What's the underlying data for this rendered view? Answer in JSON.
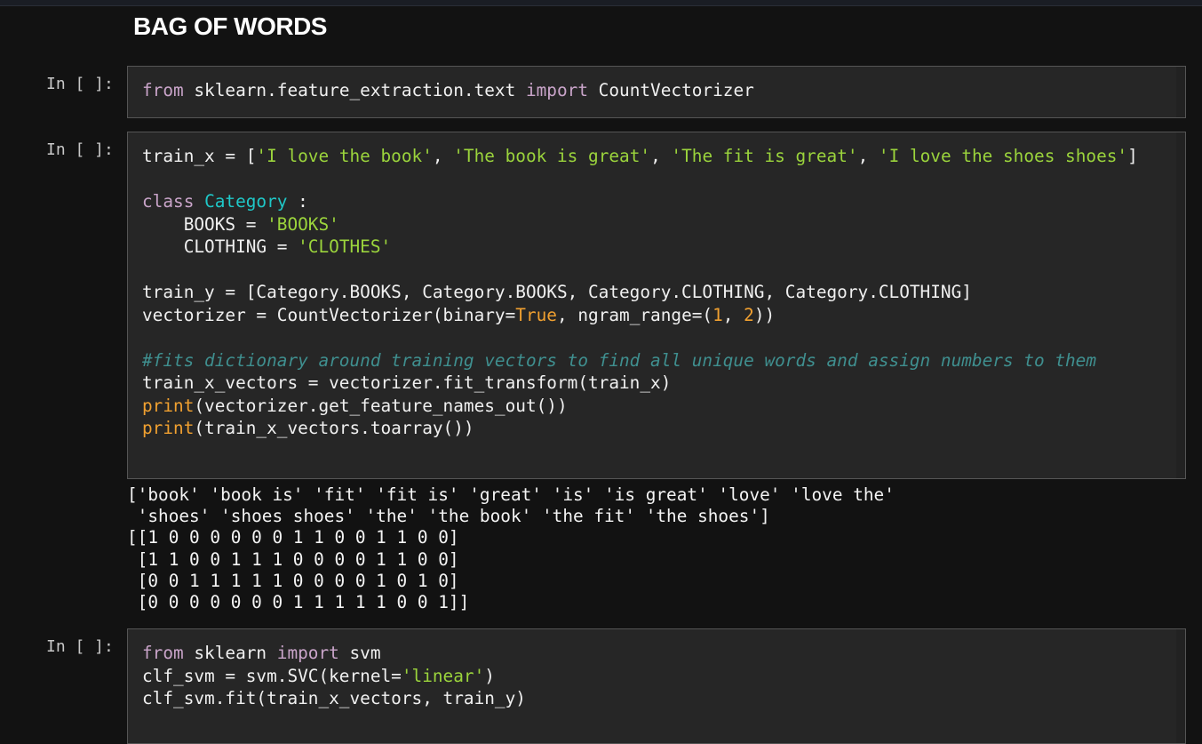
{
  "heading": "BAG OF WORDS",
  "colors": {
    "background": "#121212",
    "cell": "#262626",
    "keyword": "#c9a4c9",
    "string": "#9bd43c",
    "class": "#1fc8c8",
    "builtin": "#f0a030",
    "comment": "#3f8f8f"
  },
  "cells": [
    {
      "prompt": "In [ ]:",
      "lines": [
        [
          [
            "kw",
            "from"
          ],
          [
            "tx",
            " sklearn.feature_extraction.text "
          ],
          [
            "kw",
            "import"
          ],
          [
            "tx",
            " CountVectorizer"
          ]
        ]
      ]
    },
    {
      "prompt": "In [ ]:",
      "lines": [
        [
          [
            "tx",
            "train_x = ["
          ],
          [
            "str",
            "'I love the book'"
          ],
          [
            "tx",
            ", "
          ],
          [
            "str",
            "'The book is great'"
          ],
          [
            "tx",
            ", "
          ],
          [
            "str",
            "'The fit is great'"
          ],
          [
            "tx",
            ", "
          ],
          [
            "str",
            "'I love the shoes shoes'"
          ],
          [
            "tx",
            "]"
          ]
        ],
        [],
        [
          [
            "kw",
            "class"
          ],
          [
            "tx",
            " "
          ],
          [
            "cls",
            "Category"
          ],
          [
            "tx",
            " :"
          ]
        ],
        [
          [
            "tx",
            "    BOOKS = "
          ],
          [
            "str",
            "'BOOKS'"
          ]
        ],
        [
          [
            "tx",
            "    CLOTHING = "
          ],
          [
            "str",
            "'CLOTHES'"
          ]
        ],
        [],
        [
          [
            "tx",
            "train_y = [Category.BOOKS, Category.BOOKS, Category.CLOTHING, Category.CLOTHING]"
          ]
        ],
        [
          [
            "tx",
            "vectorizer = CountVectorizer(binary="
          ],
          [
            "num",
            "True"
          ],
          [
            "tx",
            ", ngram_range=("
          ],
          [
            "num",
            "1"
          ],
          [
            "tx",
            ", "
          ],
          [
            "num",
            "2"
          ],
          [
            "tx",
            "))"
          ]
        ],
        [],
        [
          [
            "cm",
            "#fits dictionary around training vectors to find all unique words and assign numbers to them"
          ]
        ],
        [
          [
            "tx",
            "train_x_vectors = vectorizer.fit_transform(train_x)"
          ]
        ],
        [
          [
            "fn",
            "print"
          ],
          [
            "tx",
            "(vectorizer.get_feature_names_out())"
          ]
        ],
        [
          [
            "fn",
            "print"
          ],
          [
            "tx",
            "(train_x_vectors.toarray())"
          ]
        ]
      ],
      "output": [
        "['book' 'book is' 'fit' 'fit is' 'great' 'is' 'is great' 'love' 'love the'",
        " 'shoes' 'shoes shoes' 'the' 'the book' 'the fit' 'the shoes']",
        "[[1 0 0 0 0 0 0 1 1 0 0 1 1 0 0]",
        " [1 1 0 0 1 1 1 0 0 0 0 1 1 0 0]",
        " [0 0 1 1 1 1 1 0 0 0 0 1 0 1 0]",
        " [0 0 0 0 0 0 0 1 1 1 1 1 0 0 1]]"
      ]
    },
    {
      "prompt": "In [ ]:",
      "lines": [
        [
          [
            "kw",
            "from"
          ],
          [
            "tx",
            " sklearn "
          ],
          [
            "kw",
            "import"
          ],
          [
            "tx",
            " svm"
          ]
        ],
        [
          [
            "tx",
            "clf_svm = svm.SVC(kernel="
          ],
          [
            "str",
            "'linear'"
          ],
          [
            "tx",
            ")"
          ]
        ],
        [
          [
            "tx",
            "clf_svm.fit(train_x_vectors, train_y)"
          ]
        ]
      ]
    }
  ]
}
